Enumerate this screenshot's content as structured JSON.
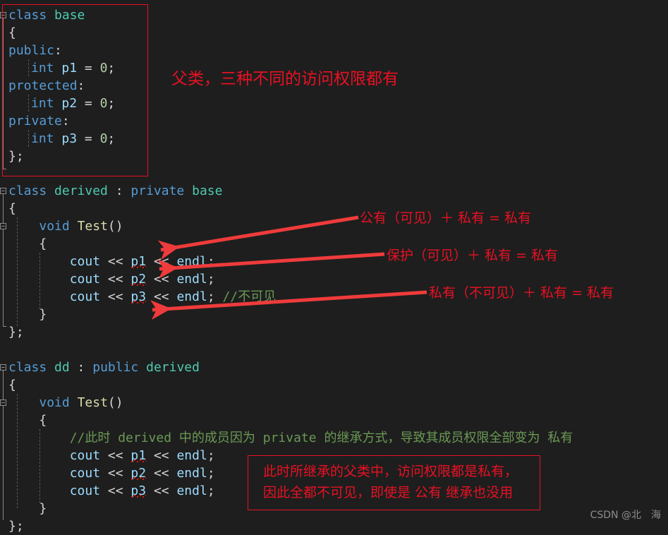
{
  "theme": {
    "background": "#1e1e1e",
    "default_text": "#d4d4d4",
    "keyword": "#569cd6",
    "class_name": "#4ec9b0",
    "identifier": "#9cdcfe",
    "number": "#b5cea8",
    "comment": "#6a9955",
    "function": "#dcdcaa",
    "annotation_red": "#e81123",
    "squiggle_red": "#e51400",
    "watermark_gray": "#8d8d8d"
  },
  "code": {
    "base_class": {
      "lines": [
        {
          "tokens": [
            {
              "t": "class",
              "c": "kw"
            },
            {
              "t": " ",
              "c": "plain"
            },
            {
              "t": "base",
              "c": "type"
            }
          ]
        },
        {
          "tokens": [
            {
              "t": "{",
              "c": "punct"
            }
          ]
        },
        {
          "tokens": [
            {
              "t": "public",
              "c": "kw"
            },
            {
              "t": ":",
              "c": "punct"
            }
          ]
        },
        {
          "indent": true,
          "tokens": [
            {
              "t": "int",
              "c": "kw"
            },
            {
              "t": " ",
              "c": "plain"
            },
            {
              "t": "p1",
              "c": "var"
            },
            {
              "t": " = ",
              "c": "punct"
            },
            {
              "t": "0",
              "c": "num"
            },
            {
              "t": ";",
              "c": "punct"
            }
          ]
        },
        {
          "tokens": [
            {
              "t": "protected",
              "c": "kw"
            },
            {
              "t": ":",
              "c": "punct"
            }
          ]
        },
        {
          "indent": true,
          "tokens": [
            {
              "t": "int",
              "c": "kw"
            },
            {
              "t": " ",
              "c": "plain"
            },
            {
              "t": "p2",
              "c": "var"
            },
            {
              "t": " = ",
              "c": "punct"
            },
            {
              "t": "0",
              "c": "num"
            },
            {
              "t": ";",
              "c": "punct"
            }
          ]
        },
        {
          "tokens": [
            {
              "t": "private",
              "c": "kw"
            },
            {
              "t": ":",
              "c": "punct"
            }
          ]
        },
        {
          "indent": true,
          "tokens": [
            {
              "t": "int",
              "c": "kw"
            },
            {
              "t": " ",
              "c": "plain"
            },
            {
              "t": "p3",
              "c": "var"
            },
            {
              "t": " = ",
              "c": "punct"
            },
            {
              "t": "0",
              "c": "num"
            },
            {
              "t": ";",
              "c": "punct"
            }
          ]
        },
        {
          "tokens": [
            {
              "t": "};",
              "c": "punct"
            }
          ]
        }
      ]
    },
    "derived_class": {
      "lines": [
        {
          "tokens": [
            {
              "t": "class",
              "c": "kw"
            },
            {
              "t": " ",
              "c": "plain"
            },
            {
              "t": "derived",
              "c": "type"
            },
            {
              "t": " : ",
              "c": "punct"
            },
            {
              "t": "private",
              "c": "kw"
            },
            {
              "t": " ",
              "c": "plain"
            },
            {
              "t": "base",
              "c": "type"
            }
          ]
        },
        {
          "tokens": [
            {
              "t": "{",
              "c": "punct"
            }
          ]
        },
        {
          "tokens": [
            {
              "t": "    ",
              "c": "plain"
            },
            {
              "t": "void",
              "c": "kw"
            },
            {
              "t": " ",
              "c": "plain"
            },
            {
              "t": "Test",
              "c": "fn"
            },
            {
              "t": "()",
              "c": "punct"
            }
          ]
        },
        {
          "tokens": [
            {
              "t": "    {",
              "c": "punct"
            }
          ]
        },
        {
          "tokens": [
            {
              "t": "        ",
              "c": "plain"
            },
            {
              "t": "cout",
              "c": "var"
            },
            {
              "t": " << ",
              "c": "punct"
            },
            {
              "t": "p1",
              "c": "var sq"
            },
            {
              "t": " << ",
              "c": "punct"
            },
            {
              "t": "endl",
              "c": "var"
            },
            {
              "t": ";",
              "c": "punct"
            }
          ]
        },
        {
          "tokens": [
            {
              "t": "        ",
              "c": "plain"
            },
            {
              "t": "cout",
              "c": "var"
            },
            {
              "t": " << ",
              "c": "punct"
            },
            {
              "t": "p2",
              "c": "var sq"
            },
            {
              "t": " << ",
              "c": "punct"
            },
            {
              "t": "endl",
              "c": "var"
            },
            {
              "t": ";",
              "c": "punct"
            }
          ]
        },
        {
          "tokens": [
            {
              "t": "        ",
              "c": "plain"
            },
            {
              "t": "cout",
              "c": "var"
            },
            {
              "t": " << ",
              "c": "punct"
            },
            {
              "t": "p3",
              "c": "var sq"
            },
            {
              "t": " << ",
              "c": "punct"
            },
            {
              "t": "endl",
              "c": "var"
            },
            {
              "t": "; ",
              "c": "punct"
            },
            {
              "t": "//不可见",
              "c": "cmt"
            }
          ]
        },
        {
          "tokens": [
            {
              "t": "    }",
              "c": "punct"
            }
          ]
        },
        {
          "tokens": [
            {
              "t": "};",
              "c": "punct"
            }
          ]
        }
      ]
    },
    "dd_class": {
      "lines": [
        {
          "tokens": [
            {
              "t": "class",
              "c": "kw"
            },
            {
              "t": " ",
              "c": "plain"
            },
            {
              "t": "dd",
              "c": "type"
            },
            {
              "t": " : ",
              "c": "punct"
            },
            {
              "t": "public",
              "c": "kw"
            },
            {
              "t": " ",
              "c": "plain"
            },
            {
              "t": "derived",
              "c": "type"
            }
          ]
        },
        {
          "tokens": [
            {
              "t": "{",
              "c": "punct"
            }
          ]
        },
        {
          "tokens": [
            {
              "t": "    ",
              "c": "plain"
            },
            {
              "t": "void",
              "c": "kw"
            },
            {
              "t": " ",
              "c": "plain"
            },
            {
              "t": "Test",
              "c": "fn"
            },
            {
              "t": "()",
              "c": "punct"
            }
          ]
        },
        {
          "tokens": [
            {
              "t": "    {",
              "c": "punct"
            }
          ]
        },
        {
          "tokens": [
            {
              "t": "        ",
              "c": "plain"
            },
            {
              "t": "//此时 derived 中的成员因为 private 的继承方式，导致其成员权限全部变为 私有",
              "c": "cmt"
            }
          ]
        },
        {
          "tokens": [
            {
              "t": "        ",
              "c": "plain"
            },
            {
              "t": "cout",
              "c": "var"
            },
            {
              "t": " << ",
              "c": "punct"
            },
            {
              "t": "p1",
              "c": "var sq"
            },
            {
              "t": " << ",
              "c": "punct"
            },
            {
              "t": "endl",
              "c": "var"
            },
            {
              "t": ";",
              "c": "punct"
            }
          ]
        },
        {
          "tokens": [
            {
              "t": "        ",
              "c": "plain"
            },
            {
              "t": "cout",
              "c": "var"
            },
            {
              "t": " << ",
              "c": "punct"
            },
            {
              "t": "p2",
              "c": "var sq"
            },
            {
              "t": " << ",
              "c": "punct"
            },
            {
              "t": "endl",
              "c": "var"
            },
            {
              "t": ";",
              "c": "punct"
            }
          ]
        },
        {
          "tokens": [
            {
              "t": "        ",
              "c": "plain"
            },
            {
              "t": "cout",
              "c": "var"
            },
            {
              "t": " << ",
              "c": "punct"
            },
            {
              "t": "p3",
              "c": "var sq"
            },
            {
              "t": " << ",
              "c": "punct"
            },
            {
              "t": "endl",
              "c": "var"
            },
            {
              "t": ";",
              "c": "punct"
            }
          ]
        },
        {
          "tokens": [
            {
              "t": "    }",
              "c": "punct"
            }
          ]
        },
        {
          "tokens": [
            {
              "t": "};",
              "c": "punct"
            }
          ]
        }
      ]
    }
  },
  "annotations": {
    "base_note": "父类，三种不同的访问权限都有",
    "arrow_note_public": "公有（可见）＋ 私有 = 私有",
    "arrow_note_protected": "保护（可见）＋ 私有 = 私有",
    "arrow_note_private": "私有（不可见）＋ 私有 = 私有",
    "bottom_box_line1": "此时所继承的父类中，访问权限都是私有，",
    "bottom_box_line2": "因此全都不可见，即使是 公有 继承也没用"
  },
  "watermark": {
    "text": "CSDN @北　海"
  }
}
